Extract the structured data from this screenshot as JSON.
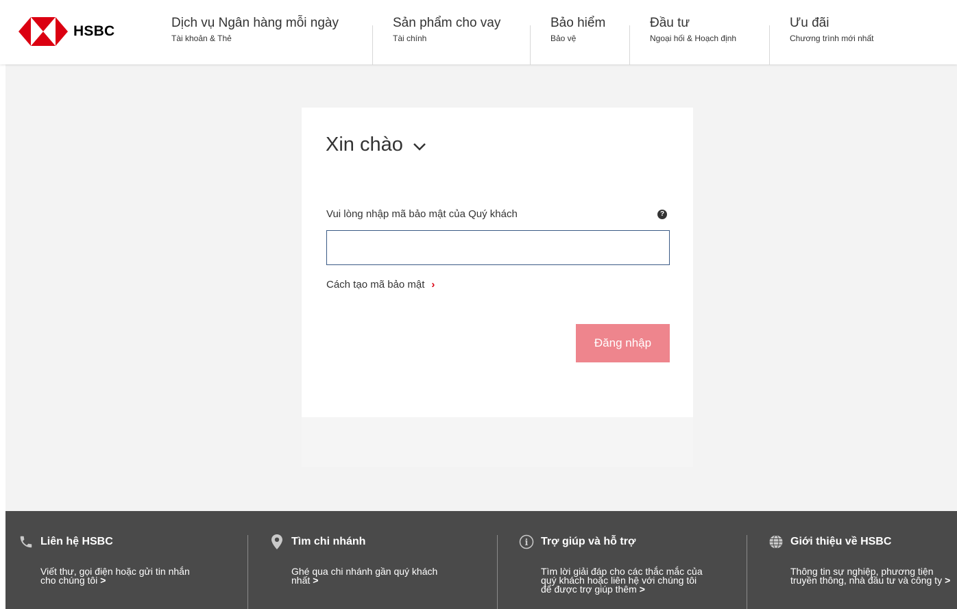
{
  "brand": {
    "name": "HSBC",
    "accent": "#db0011"
  },
  "nav": [
    {
      "title": "Dịch vụ Ngân hàng mỗi ngày",
      "subtitle": "Tài khoản & Thẻ"
    },
    {
      "title": "Sản phẩm cho vay",
      "subtitle": "Tài chính"
    },
    {
      "title": "Bảo hiểm",
      "subtitle": "Bảo vệ"
    },
    {
      "title": "Đầu tư",
      "subtitle": "Ngoại hối & Hoạch định"
    },
    {
      "title": "Ưu đãi",
      "subtitle": "Chương trình mới nhất"
    }
  ],
  "login": {
    "greeting": "Xin chào",
    "field_label": "Vui lòng nhập mã bảo mật của Quý khách",
    "help_icon": "?",
    "code_value": "",
    "howto_link": "Cách tạo mã bảo mật",
    "submit_label": "Đăng nhập",
    "submit_color": "#ee858d"
  },
  "footer": [
    {
      "icon": "phone-icon",
      "title": "Liên hệ HSBC",
      "desc": "Viết thư, gọi điện hoặc gửi tin nhắn cho chúng tôi"
    },
    {
      "icon": "location-pin-icon",
      "title": "Tìm chi nhánh",
      "desc": "Ghé qua chi nhánh gần quý khách nhất"
    },
    {
      "icon": "info-icon",
      "title": "Trợ giúp và hỗ trợ",
      "desc": "Tìm lời giải đáp cho các thắc mắc của quý khách hoặc liên hệ với chúng tôi để được trợ giúp thêm"
    },
    {
      "icon": "globe-icon",
      "title": "Giới thiệu về HSBC",
      "desc": "Thông tin sự nghiệp, phương tiện truyền thông, nhà đầu tư và công ty"
    }
  ],
  "footer_arrow": ">"
}
